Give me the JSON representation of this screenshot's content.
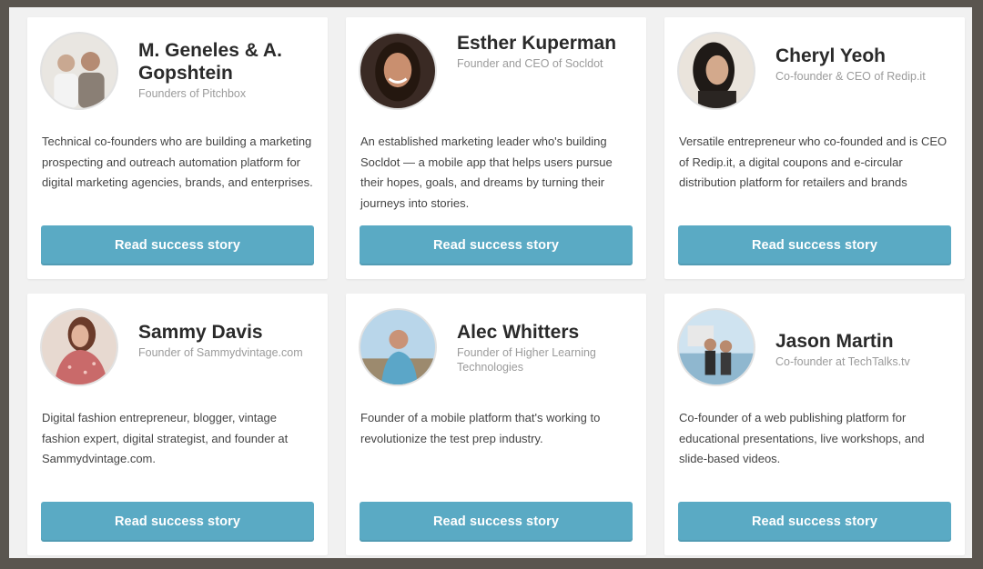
{
  "cards": [
    {
      "name": "M. Geneles & A. Gopshtein",
      "title": "Founders of Pitchbox",
      "description": "Technical co-founders who are building a marketing prospecting and outreach automation platform for digital marketing agencies, brands, and enterprises.",
      "button": "Read success story"
    },
    {
      "name": "Esther Kuperman",
      "title": "Founder and CEO of Socldot",
      "description": "An established marketing leader who's building Socldot — a mobile app that helps users pursue their hopes, goals, and dreams by turning their journeys into stories.",
      "button": "Read success story"
    },
    {
      "name": "Cheryl Yeoh",
      "title": "Co-founder & CEO of Redip.it",
      "description": "Versatile entrepreneur who co-founded and is CEO of Redip.it, a digital coupons and e-circular distribution platform for retailers and brands",
      "button": "Read success story"
    },
    {
      "name": "Sammy Davis",
      "title": "Founder of Sammydvintage.com",
      "description": "Digital fashion entrepreneur, blogger, vintage fashion expert, digital strategist, and founder at Sammydvintage.com.",
      "button": "Read success story"
    },
    {
      "name": "Alec Whitters",
      "title": "Founder of Higher Learning Technologies",
      "description": "Founder of a mobile platform that's working to revolutionize the test prep industry.",
      "button": "Read success story"
    },
    {
      "name": "Jason Martin",
      "title": "Co-founder at TechTalks.tv",
      "description": "Co-founder of a web publishing platform for educational presentations, live workshops, and slide-based videos.",
      "button": "Read success story"
    }
  ],
  "colors": {
    "button": "#5aaac4",
    "frame": "#5a554f",
    "background": "#f1f1f1"
  }
}
